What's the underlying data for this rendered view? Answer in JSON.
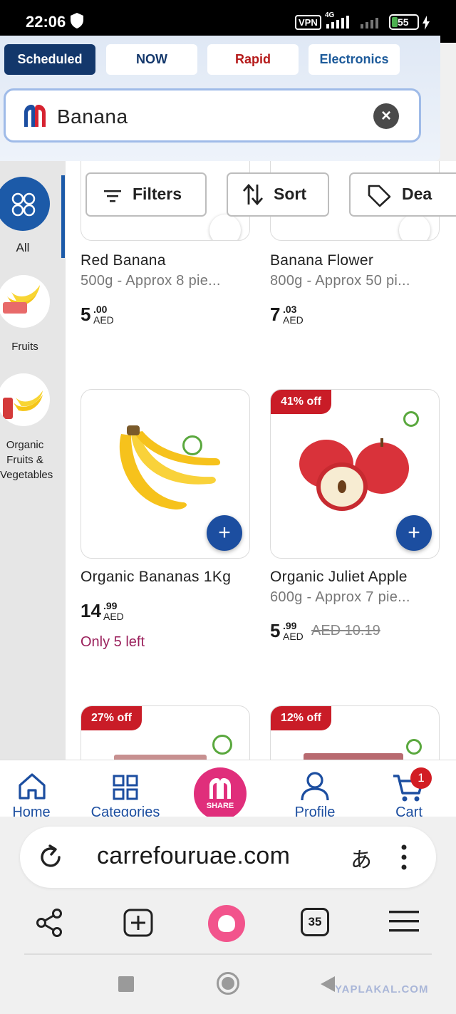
{
  "status_bar": {
    "time": "22:06",
    "network": "4G",
    "vpn": "VPN",
    "battery": "55"
  },
  "header": {
    "tabs": [
      {
        "label": "Scheduled",
        "active": true
      },
      {
        "label": "NOW"
      },
      {
        "label": "Rapid"
      },
      {
        "label": "Electronics"
      }
    ],
    "search": {
      "value": "Banana"
    }
  },
  "sidebar": {
    "items": [
      {
        "label": "All",
        "active": true
      },
      {
        "label": "Fruits"
      },
      {
        "label": "Organic Fruits & Vegetables"
      }
    ]
  },
  "filters": {
    "filters_label": "Filters",
    "sort_label": "Sort",
    "deals_label": "Dea"
  },
  "products": [
    {
      "name": "Red Banana",
      "desc": "500g - Approx 8 pie...",
      "price_int": "5",
      "price_dec": ".00",
      "currency": "AED"
    },
    {
      "name": "Banana Flower",
      "desc": "800g - Approx 50 pi...",
      "price_int": "7",
      "price_dec": ".03",
      "currency": "AED"
    },
    {
      "name": "Organic Bananas 1Kg",
      "price_int": "14",
      "price_dec": ".99",
      "currency": "AED",
      "stock": "Only 5 left"
    },
    {
      "name": "Organic Juliet Apple",
      "desc": "600g - Approx 7 pie...",
      "price_int": "5",
      "price_dec": ".99",
      "currency": "AED",
      "old_price": "AED 10.19",
      "discount": "41% off"
    },
    {
      "discount": "27% off"
    },
    {
      "discount": "12% off"
    }
  ],
  "bottom_nav": {
    "home": "Home",
    "categories": "Categories",
    "share": "SHARE",
    "profile": "Profile",
    "cart": "Cart",
    "cart_count": "1"
  },
  "browser": {
    "url": "carrefouruae.com",
    "translate": "あ",
    "tab_count": "35"
  },
  "watermark": "YAPLAKAL.COM",
  "colors": {
    "brand_blue": "#1c4ea0",
    "dark_blue": "#13376b",
    "discount_red": "#c91c27",
    "share_pink": "#e02e7b"
  }
}
